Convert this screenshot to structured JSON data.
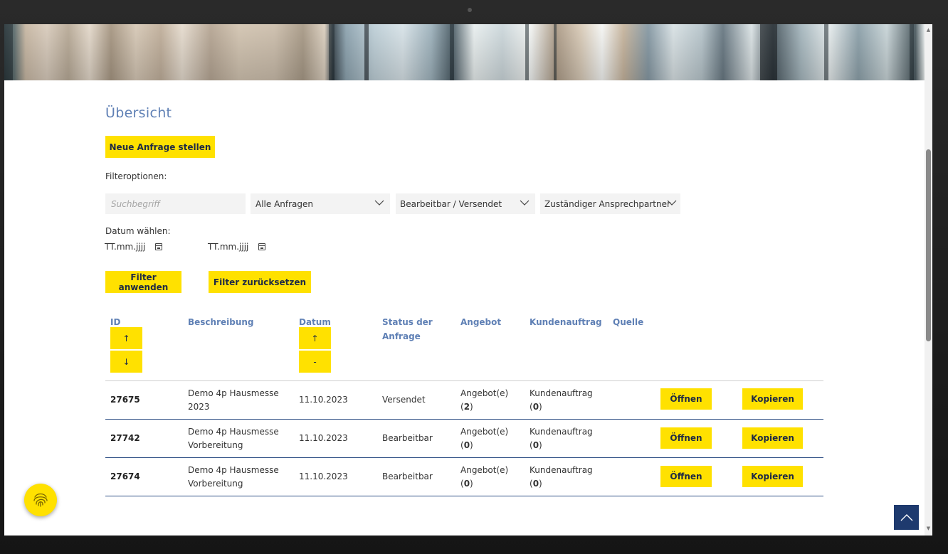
{
  "page": {
    "title": "Übersicht",
    "new_request_button": "Neue Anfrage stellen",
    "filter_options_label": "Filteroptionen:",
    "search_placeholder": "Suchbegriff",
    "select_requests": "Alle Anfragen",
    "select_status": "Bearbeitbar / Versendet",
    "select_contact": "Zuständiger Ansprechpartner",
    "date_label": "Datum wählen:",
    "date_from": "TT.mm.jjjj",
    "date_to": "TT.mm.jjjj",
    "apply_filter_button": "Filter anwenden",
    "reset_filter_button": "Filter zurücksetzen"
  },
  "table": {
    "headers": {
      "id": "ID",
      "description": "Beschreibung",
      "date": "Datum",
      "status_line1": "Status der",
      "status_line2": "Anfrage",
      "offer": "Angebot",
      "customer_order": "Kundenauftrag",
      "source": "Quelle"
    },
    "sort_buttons": {
      "id_up": "↑",
      "id_down": "↓",
      "date_up": "↑",
      "date_neutral": "-"
    },
    "rows": [
      {
        "id": "27675",
        "desc_line1": "Demo 4p Hausmesse",
        "desc_line2": "2023",
        "date": "11.10.2023",
        "status": "Versendet",
        "offer_label": "Angebot(e)",
        "offer_count": "2",
        "order_label": "Kundenauftrag",
        "order_count": "0",
        "open_button": "Öffnen",
        "copy_button": "Kopieren"
      },
      {
        "id": "27742",
        "desc_line1": "Demo 4p Hausmesse",
        "desc_line2": "Vorbereitung",
        "date": "11.10.2023",
        "status": "Bearbeitbar",
        "offer_label": "Angebot(e)",
        "offer_count": "0",
        "order_label": "Kundenauftrag",
        "order_count": "0",
        "open_button": "Öffnen",
        "copy_button": "Kopieren"
      },
      {
        "id": "27674",
        "desc_line1": "Demo 4p Hausmesse",
        "desc_line2": "Vorbereitung",
        "date": "11.10.2023",
        "status": "Bearbeitbar",
        "offer_label": "Angebot(e)",
        "offer_count": "0",
        "order_label": "Kundenauftrag",
        "order_count": "0",
        "open_button": "Öffnen",
        "copy_button": "Kopieren"
      }
    ]
  },
  "icons": {
    "fab": "fingerprint-icon",
    "back_to_top": "chevron-up-icon",
    "calendar": "calendar-icon",
    "dropdown": "chevron-down-icon"
  },
  "colors": {
    "accent_yellow": "#ffe100",
    "heading_blue": "#5f80b5",
    "navy": "#1e3a6e",
    "row_divider": "#2e4f85"
  }
}
